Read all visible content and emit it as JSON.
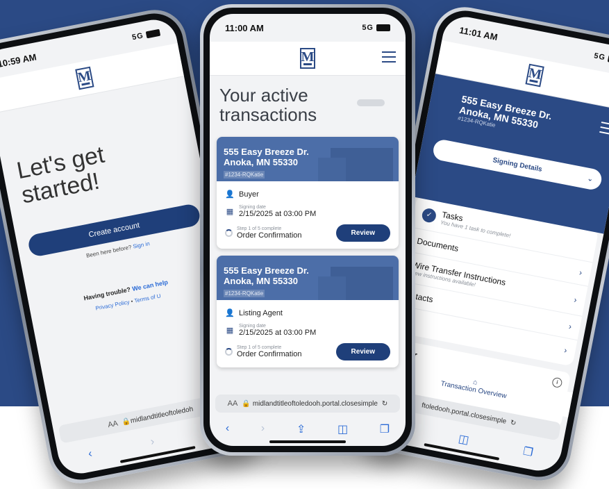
{
  "background": {
    "primary": "#2b4a85"
  },
  "left_phone": {
    "time": "10:59 AM",
    "signal": "5G",
    "heading_line1": "Let's get",
    "heading_line2": "started!",
    "create_account": "Create account",
    "been_here": "Been here before?",
    "sign_in": "Sign in",
    "having_trouble": "Having trouble?",
    "we_can_help": "We can help",
    "privacy": "Privacy Policy",
    "separator": "•",
    "terms": "Terms of U",
    "url": "midlandtitleoftoledoh"
  },
  "center_phone": {
    "time": "11:00 AM",
    "signal": "5G",
    "logo_letter": "M",
    "title_line1": "Your active",
    "title_line2": "transactions",
    "cards": [
      {
        "address_line1": "555 Easy Breeze Dr.",
        "address_line2": "Anoka, MN 55330",
        "code": "#1234-RQKatie",
        "role": "Buyer",
        "signing_label": "Signing date",
        "signing_date": "2/15/2025 at 03:00 PM",
        "step": "Step 1 of 5 complete",
        "status": "Order Confirmation",
        "action": "Review"
      },
      {
        "address_line1": "555 Easy Breeze Dr.",
        "address_line2": "Anoka, MN 55330",
        "code": "#1234-RQKatie",
        "role": "Listing Agent",
        "signing_label": "Signing date",
        "signing_date": "2/15/2025 at 03:00 PM",
        "step": "Step 1 of 5 complete",
        "status": "Order Confirmation",
        "action": "Review"
      }
    ],
    "url_aa": "AA",
    "url": "midlandtitleoftoledooh.portal.closesimple"
  },
  "right_phone": {
    "time": "11:01 AM",
    "signal": "5G",
    "address_line1": "555 Easy Breeze Dr.",
    "address_line2": "Anoka, MN 55330",
    "code": "#1234-RQKatie",
    "signing_details": "Signing Details",
    "items": [
      {
        "label": "Tasks",
        "sub": "You have 1 task to complete!"
      },
      {
        "label": "Documents",
        "sub": ""
      },
      {
        "label": "Wire Transfer Instructions",
        "sub": "New instructions available!"
      },
      {
        "label": "ontacts",
        "sub": ""
      },
      {
        "label": "",
        "sub": ""
      }
    ],
    "tracker_label": "acker",
    "tracker_sub": "plete",
    "tab_label": "Transaction Overview",
    "url": "ftoledooh.portal.closesimple"
  }
}
